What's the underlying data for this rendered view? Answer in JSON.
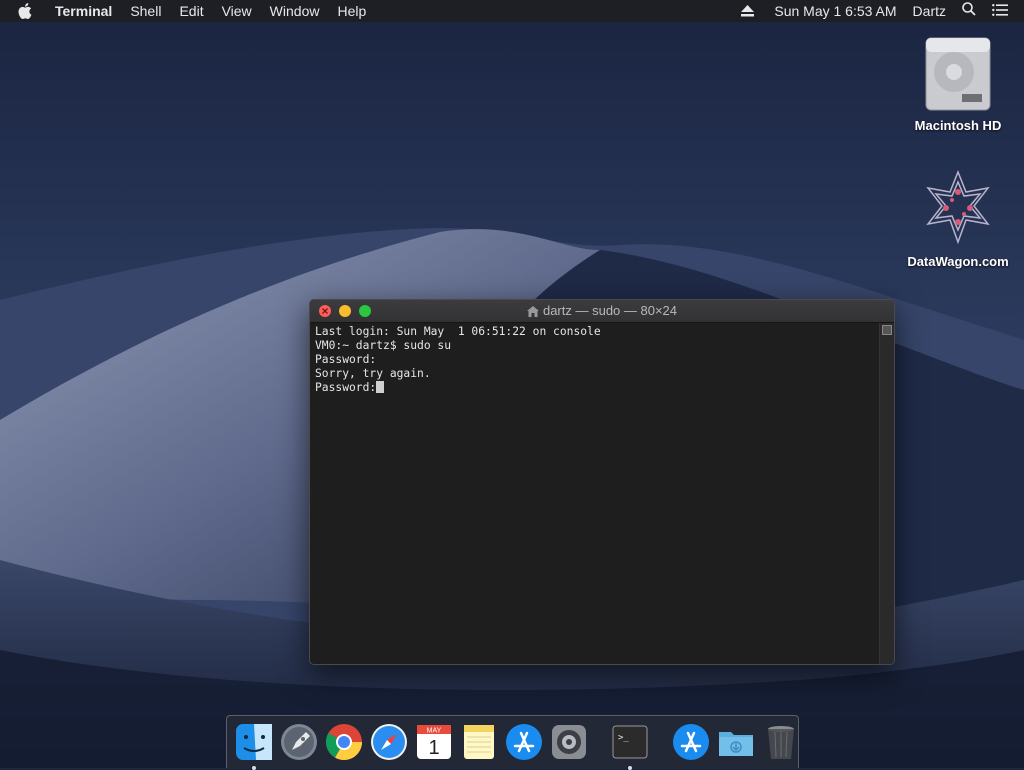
{
  "menubar": {
    "app_name": "Terminal",
    "menus": [
      "Shell",
      "Edit",
      "View",
      "Window",
      "Help"
    ],
    "clock": "Sun May 1  6:53 AM",
    "user": "Dartz"
  },
  "desktop": {
    "icons": [
      {
        "label": "Macintosh HD"
      },
      {
        "label": "DataWagon.com"
      }
    ]
  },
  "terminal": {
    "title": "dartz — sudo — 80×24",
    "lines": [
      "Last login: Sun May  1 06:51:22 on console",
      "VM0:~ dartz$ sudo su",
      "Password:",
      "Sorry, try again.",
      "Password:"
    ]
  },
  "dock": {
    "calendar_month": "MAY",
    "calendar_day": "1",
    "terminal_prompt": ">_",
    "items": [
      "finder-icon",
      "launchpad-icon",
      "chrome-icon",
      "safari-icon",
      "calendar-icon",
      "notes-icon",
      "app-store-icon",
      "system-preferences-icon",
      "terminal-icon",
      "app-store-downloads-icon",
      "downloads-folder-icon",
      "trash-icon"
    ]
  },
  "colors": {
    "menubar_bg": "#1e1f24",
    "terminal_bg": "#1e1e1e",
    "close": "#fc5f57",
    "minimize": "#fdbc2e",
    "zoom": "#28c840"
  }
}
